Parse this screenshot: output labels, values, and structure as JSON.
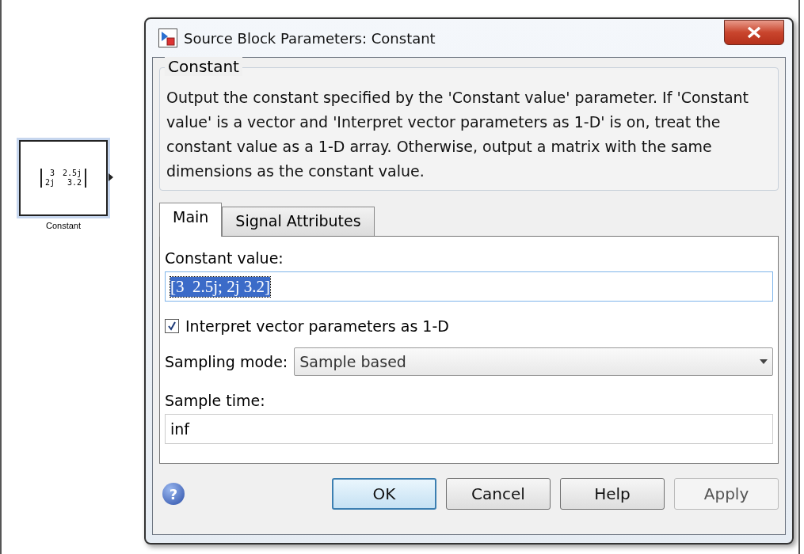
{
  "block": {
    "matrix": [
      [
        "3",
        "2.5j"
      ],
      [
        "2j",
        "3.2"
      ]
    ],
    "label": "Constant"
  },
  "dialog": {
    "title": "Source Block Parameters: Constant",
    "group": {
      "legend": "Constant",
      "description": "Output the constant specified by the 'Constant value' parameter. If 'Constant value' is a vector and 'Interpret vector parameters as 1-D' is on, treat the constant value as a 1-D array. Otherwise, output a matrix with the same dimensions as the constant value."
    },
    "tabs": [
      {
        "label": "Main",
        "selected": true
      },
      {
        "label": "Signal Attributes",
        "selected": false
      }
    ],
    "fields": [
      {
        "kind": "text",
        "label": "Constant value:",
        "value": "[3  2.5j; 2j 3.2]",
        "text_selected": true
      },
      {
        "kind": "checkbox",
        "label": "Interpret vector parameters as 1-D",
        "checked": true
      },
      {
        "kind": "select",
        "label": "Sampling mode:",
        "value": "Sample based"
      },
      {
        "kind": "text",
        "label": "Sample time:",
        "value": "inf",
        "text_selected": false
      }
    ],
    "help_icon": "?",
    "buttons": [
      {
        "label": "OK",
        "default": true,
        "disabled": false
      },
      {
        "label": "Cancel",
        "default": false,
        "disabled": false
      },
      {
        "label": "Help",
        "default": false,
        "disabled": false
      },
      {
        "label": "Apply",
        "default": false,
        "disabled": true
      }
    ]
  }
}
